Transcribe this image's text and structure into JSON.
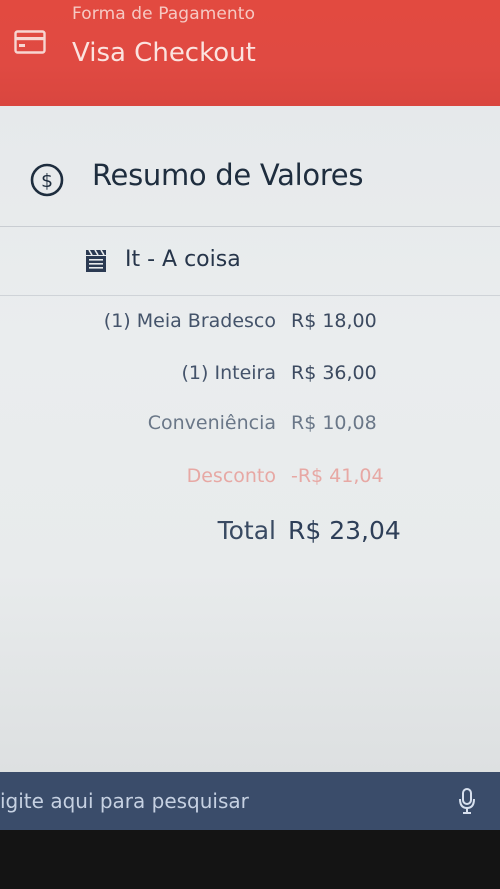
{
  "payment_header": {
    "subtitle": "Forma de Pagamento",
    "title": "Visa Checkout",
    "icon": "credit-card-icon"
  },
  "summary": {
    "title": "Resumo de Valores",
    "icon": "dollar-circle-icon"
  },
  "event": {
    "name": "It - A coisa",
    "icon": "film-icon"
  },
  "line_items": [
    {
      "label": "(1) Meia Bradesco",
      "value": "R$ 18,00"
    },
    {
      "label": "(1) Inteira",
      "value": "R$ 36,00"
    },
    {
      "label": "Conveniência",
      "value": "R$ 10,08"
    },
    {
      "label": "Desconto",
      "value": "-R$ 41,04"
    }
  ],
  "total": {
    "label": "Total",
    "value": "R$ 23,04"
  },
  "taskbar": {
    "search_placeholder": "igite aqui para pesquisar",
    "mic_icon": "microphone-icon"
  },
  "colors": {
    "header_red": "#e24a40",
    "discount": "#e7a8a4",
    "taskbar": "#3a4c6a"
  }
}
